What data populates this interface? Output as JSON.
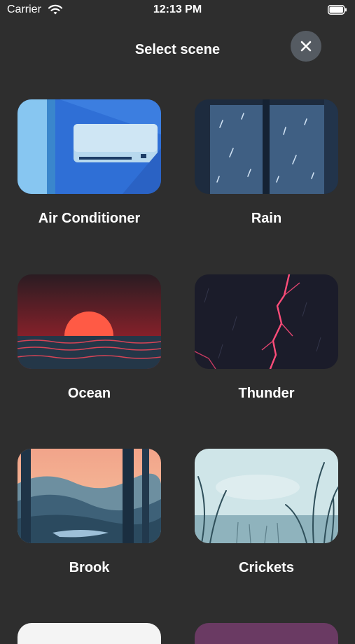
{
  "status_bar": {
    "carrier": "Carrier",
    "time": "12:13 PM"
  },
  "header": {
    "title": "Select scene",
    "close_icon": "close-icon"
  },
  "scenes": [
    {
      "label": "Air Conditioner",
      "icon": "air-conditioner-image"
    },
    {
      "label": "Rain",
      "icon": "rain-window-image"
    },
    {
      "label": "Ocean",
      "icon": "ocean-sunset-image"
    },
    {
      "label": "Thunder",
      "icon": "lightning-storm-image"
    },
    {
      "label": "Brook",
      "icon": "forest-brook-image"
    },
    {
      "label": "Crickets",
      "icon": "grass-field-image"
    }
  ]
}
